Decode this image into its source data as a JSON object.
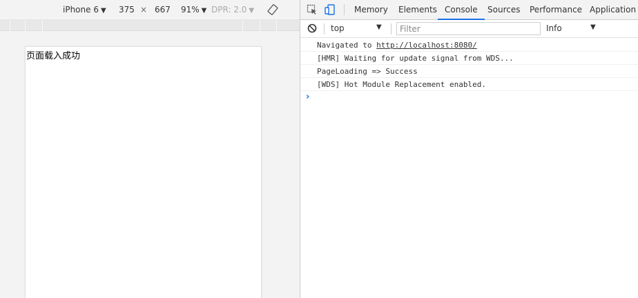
{
  "device_toolbar": {
    "device": "iPhone 6",
    "width": "375",
    "times": "×",
    "height": "667",
    "zoom": "91%",
    "dpr": "DPR: 2.0",
    "caret": "▼"
  },
  "viewport": {
    "text": "页面载入成功"
  },
  "devtools": {
    "tabs": [
      "Memory",
      "Elements",
      "Console",
      "Sources",
      "Performance",
      "Application"
    ],
    "active_tab": "Console",
    "accent": "#1a73e8",
    "filterbar": {
      "context": "top",
      "filter_placeholder": "Filter",
      "level": "Info",
      "caret": "▼"
    },
    "console": {
      "lines": [
        {
          "prefix": "Navigated to ",
          "link": "http://localhost:8080/"
        },
        {
          "text": "[HMR] Waiting for update signal from WDS..."
        },
        {
          "text": "PageLoading => Success"
        },
        {
          "text": "[WDS] Hot Module Replacement enabled."
        }
      ],
      "prompt": "›"
    }
  },
  "icons": [
    "rotate-icon",
    "inspect-icon",
    "device-toggle-icon",
    "clear-console-icon"
  ]
}
